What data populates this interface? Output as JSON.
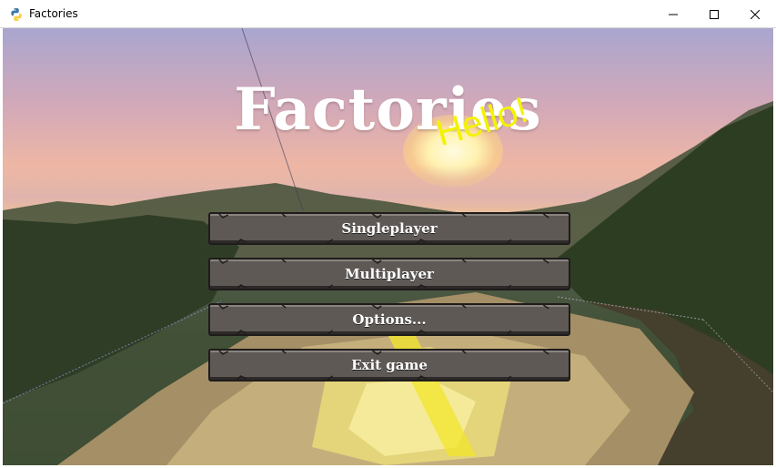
{
  "window": {
    "title": "Factories",
    "controls": {
      "minimize_icon": "minimize-icon",
      "maximize_icon": "maximize-icon",
      "close_icon": "close-icon"
    }
  },
  "game": {
    "title": "Factories",
    "splash": "Hello!",
    "splash_color": "#f3f300"
  },
  "menu": {
    "buttons": [
      {
        "label": "Singleplayer"
      },
      {
        "label": "Multiplayer"
      },
      {
        "label": "Options..."
      },
      {
        "label": "Exit game"
      }
    ]
  },
  "colors": {
    "button_bg": "#5f5956",
    "button_border": "#1f1c1b",
    "title_text": "#ffffff"
  }
}
